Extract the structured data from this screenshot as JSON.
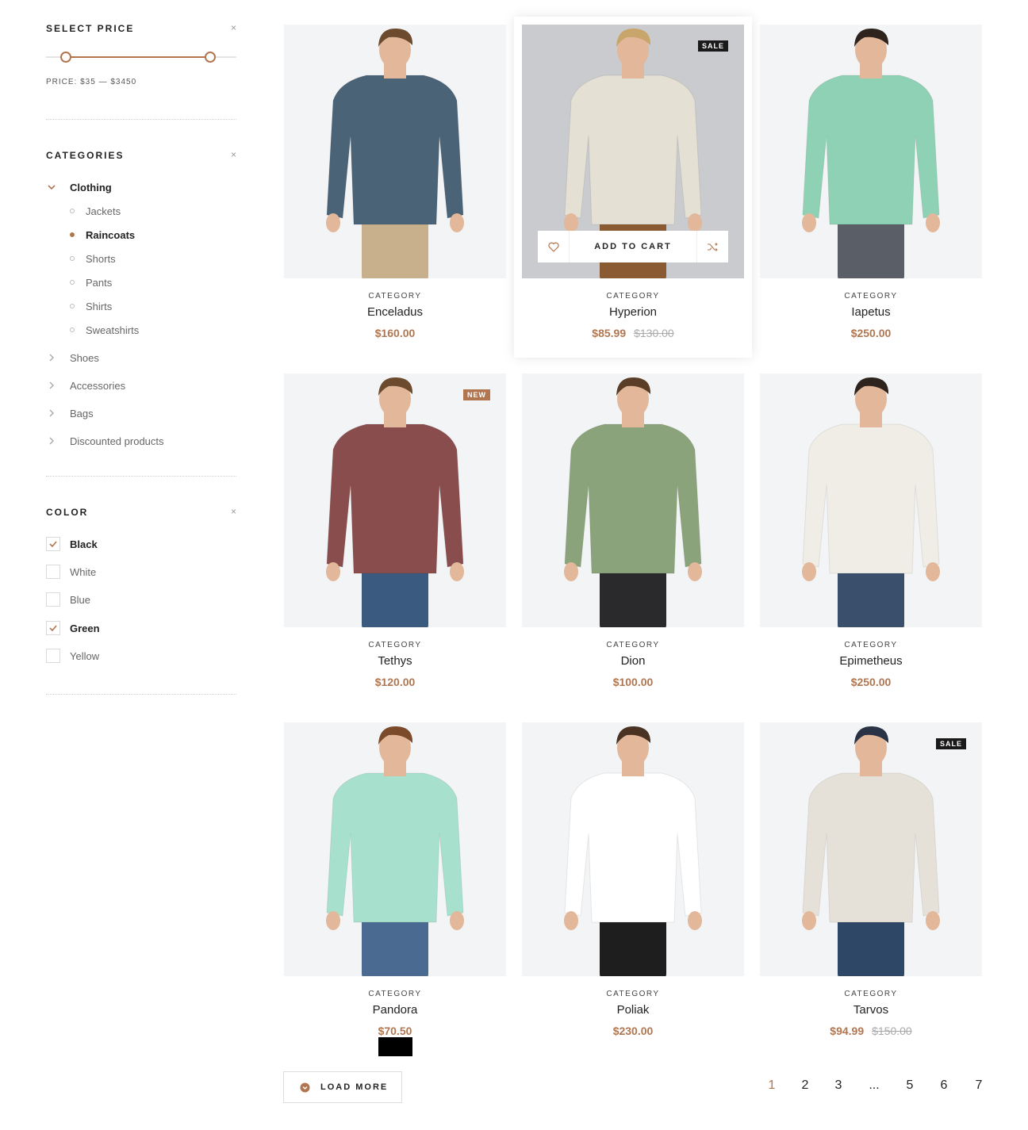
{
  "filters": {
    "price": {
      "title": "SELECT PRICE",
      "close": "×",
      "range_text": "PRICE: $35 — $3450",
      "min_fraction": 0.104,
      "max_fraction": 0.863
    },
    "categories": {
      "title": "CATEGORIES",
      "close": "×",
      "top": [
        {
          "label": "Clothing",
          "expanded": true,
          "active": true
        },
        {
          "label": "Shoes"
        },
        {
          "label": "Accessories"
        },
        {
          "label": "Bags"
        },
        {
          "label": "Discounted products"
        }
      ],
      "clothing_sub": [
        {
          "label": "Jackets",
          "active": false
        },
        {
          "label": "Raincoats",
          "active": true
        },
        {
          "label": "Shorts",
          "active": false
        },
        {
          "label": "Pants",
          "active": false
        },
        {
          "label": "Shirts",
          "active": false
        },
        {
          "label": "Sweatshirts",
          "active": false
        }
      ]
    },
    "color": {
      "title": "COLOR",
      "close": "×",
      "options": [
        {
          "label": "Black",
          "checked": true
        },
        {
          "label": "White",
          "checked": false
        },
        {
          "label": "Blue",
          "checked": false
        },
        {
          "label": "Green",
          "checked": true
        },
        {
          "label": "Yellow",
          "checked": false
        }
      ]
    }
  },
  "products": [
    {
      "category": "CATEGORY",
      "name": "Enceladus",
      "price": "$160.00",
      "old_price": "",
      "badge": "",
      "shirt": "#4a6377",
      "pants": "#c9b08c",
      "hair": "#6b4a2e"
    },
    {
      "category": "CATEGORY",
      "name": "Hyperion",
      "price": "$85.99",
      "old_price": "$130.00",
      "badge": "SALE",
      "shirt": "#e5e0d4",
      "pants": "#8a5a32",
      "hair": "#c8a56a"
    },
    {
      "category": "CATEGORY",
      "name": "Iapetus",
      "price": "$250.00",
      "old_price": "",
      "badge": "",
      "shirt": "#8fd1b4",
      "pants": "#5a5f67",
      "hair": "#2e241d"
    },
    {
      "category": "CATEGORY",
      "name": "Tethys",
      "price": "$120.00",
      "old_price": "",
      "badge": "NEW",
      "shirt": "#8a4d4d",
      "pants": "#3b5a80",
      "hair": "#6b4a2e"
    },
    {
      "category": "CATEGORY",
      "name": "Dion",
      "price": "$100.00",
      "old_price": "",
      "badge": "",
      "shirt": "#8aa37a",
      "pants": "#2a2a2c",
      "hair": "#5a3e28"
    },
    {
      "category": "CATEGORY",
      "name": "Epimetheus",
      "price": "$250.00",
      "old_price": "",
      "badge": "",
      "shirt": "#f0ede6",
      "pants": "#3a4f6b",
      "hair": "#2e241d"
    },
    {
      "category": "CATEGORY",
      "name": "Pandora",
      "price": "$70.50",
      "old_price": "",
      "badge": "",
      "shirt": "#a7e0cd",
      "pants": "#4a6a92",
      "hair": "#7a4a2a"
    },
    {
      "category": "CATEGORY",
      "name": "Poliak",
      "price": "$230.00",
      "old_price": "",
      "badge": "",
      "shirt": "#ffffff",
      "pants": "#1e1e1e",
      "hair": "#4a3322"
    },
    {
      "category": "CATEGORY",
      "name": "Tarvos",
      "price": "$94.99",
      "old_price": "$150.00",
      "badge": "SALE",
      "shirt": "#e6e1d8",
      "pants": "#2e4766",
      "hair": "#2a3346"
    }
  ],
  "hover_card": {
    "add_to_cart": "ADD TO CART",
    "wishlist_icon": "heart-icon",
    "compare_icon": "shuffle-icon"
  },
  "footer": {
    "load_more": "LOAD MORE",
    "load_more_icon": "arrow-down-circle-icon",
    "pages": [
      "1",
      "2",
      "3",
      "...",
      "5",
      "6",
      "7"
    ],
    "current_page": "1"
  },
  "colors": {
    "accent": "#b17650",
    "sale_badge": "#1a1a1a",
    "new_badge": "#b17650",
    "card_bg": "#f3f4f6"
  }
}
